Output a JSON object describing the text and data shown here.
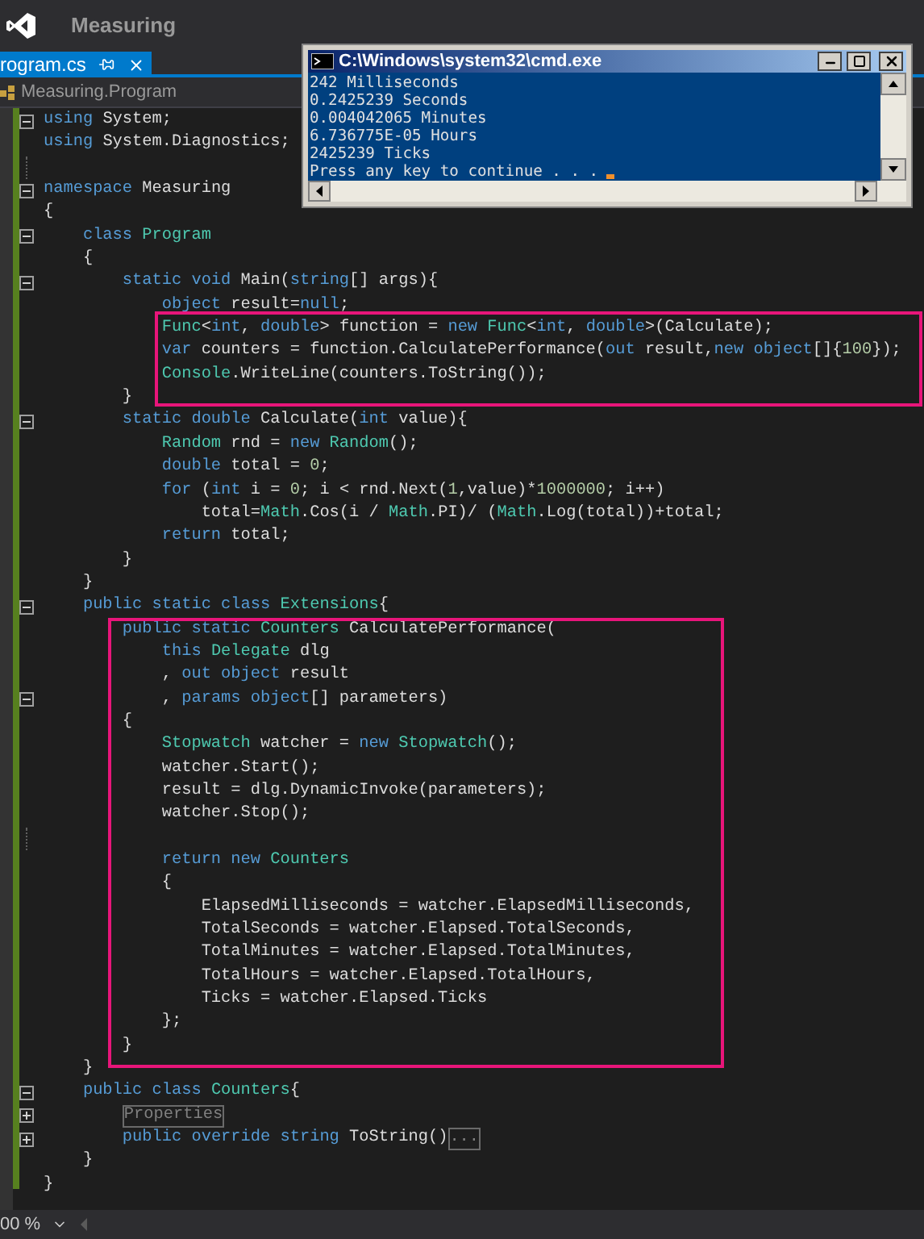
{
  "app": {
    "title": "Measuring"
  },
  "tab": {
    "label": "rogram.cs",
    "selected": true
  },
  "nav": {
    "label": "Measuring.Program"
  },
  "code": {
    "lines": [
      {
        "collapsed": false,
        "segs": [
          {
            "t": "using",
            "kind": "keyword"
          },
          {
            "t": " System;",
            "kind": "plain"
          }
        ]
      },
      {
        "segs": [
          {
            "t": "using",
            "kind": "keyword"
          },
          {
            "t": " System.Diagnostics;",
            "kind": "plain"
          }
        ]
      },
      {
        "kind": "blank"
      },
      {
        "collapsed": false,
        "segs": [
          {
            "t": "namespace",
            "kind": "keyword"
          },
          {
            "t": " Measuring",
            "kind": "plain"
          }
        ]
      },
      {
        "segs": [
          {
            "t": "{",
            "kind": "plain"
          }
        ]
      },
      {
        "collapsed": false,
        "segs": [
          {
            "t": "    class",
            "kind": "keyword"
          },
          {
            "t": " Program",
            "kind": "type"
          }
        ]
      },
      {
        "segs": [
          {
            "t": "    {",
            "kind": "plain"
          }
        ]
      },
      {
        "collapsed": false,
        "segs": [
          {
            "t": "        static void",
            "kind": "keyword"
          },
          {
            "t": " Main(",
            "kind": "plain"
          },
          {
            "t": "string",
            "kind": "keyword"
          },
          {
            "t": "[] args){",
            "kind": "plain"
          }
        ]
      },
      {
        "segs": [
          {
            "t": "            object",
            "kind": "keyword"
          },
          {
            "t": " result=",
            "kind": "plain"
          },
          {
            "t": "null",
            "kind": "keyword"
          },
          {
            "t": ";",
            "kind": "plain"
          }
        ]
      },
      {
        "segs": [
          {
            "t": "            Func",
            "kind": "type"
          },
          {
            "t": "<",
            "kind": "plain"
          },
          {
            "t": "int",
            "kind": "keyword"
          },
          {
            "t": ", ",
            "kind": "plain"
          },
          {
            "t": "double",
            "kind": "keyword"
          },
          {
            "t": "> function = ",
            "kind": "plain"
          },
          {
            "t": "new",
            "kind": "keyword"
          },
          {
            "t": " Func",
            "kind": "type"
          },
          {
            "t": "<",
            "kind": "plain"
          },
          {
            "t": "int",
            "kind": "keyword"
          },
          {
            "t": ", ",
            "kind": "plain"
          },
          {
            "t": "double",
            "kind": "keyword"
          },
          {
            "t": ">(Calculate);",
            "kind": "plain"
          }
        ]
      },
      {
        "segs": [
          {
            "t": "            var",
            "kind": "keyword"
          },
          {
            "t": " counters = function.CalculatePerformance(",
            "kind": "plain"
          },
          {
            "t": "out",
            "kind": "keyword"
          },
          {
            "t": " result,",
            "kind": "plain"
          },
          {
            "t": "new object",
            "kind": "keyword"
          },
          {
            "t": "[]{",
            "kind": "plain"
          },
          {
            "t": "100",
            "kind": "number"
          },
          {
            "t": "});",
            "kind": "plain"
          }
        ]
      },
      {
        "segs": [
          {
            "t": "            Console",
            "kind": "type"
          },
          {
            "t": ".WriteLine(counters.ToString());",
            "kind": "plain"
          }
        ]
      },
      {
        "segs": [
          {
            "t": "        }",
            "kind": "plain"
          }
        ]
      },
      {
        "collapsed": false,
        "segs": [
          {
            "t": "        static double",
            "kind": "keyword"
          },
          {
            "t": " Calculate(",
            "kind": "plain"
          },
          {
            "t": "int",
            "kind": "keyword"
          },
          {
            "t": " value){",
            "kind": "plain"
          }
        ]
      },
      {
        "segs": [
          {
            "t": "            Random",
            "kind": "type"
          },
          {
            "t": " rnd = ",
            "kind": "plain"
          },
          {
            "t": "new",
            "kind": "keyword"
          },
          {
            "t": " Random",
            "kind": "type"
          },
          {
            "t": "();",
            "kind": "plain"
          }
        ]
      },
      {
        "segs": [
          {
            "t": "            double",
            "kind": "keyword"
          },
          {
            "t": " total = ",
            "kind": "plain"
          },
          {
            "t": "0",
            "kind": "number"
          },
          {
            "t": ";",
            "kind": "plain"
          }
        ]
      },
      {
        "segs": [
          {
            "t": "            for",
            "kind": "keyword"
          },
          {
            "t": " (",
            "kind": "plain"
          },
          {
            "t": "int",
            "kind": "keyword"
          },
          {
            "t": " i = ",
            "kind": "plain"
          },
          {
            "t": "0",
            "kind": "number"
          },
          {
            "t": "; i < rnd.Next(",
            "kind": "plain"
          },
          {
            "t": "1",
            "kind": "number"
          },
          {
            "t": ",value)*",
            "kind": "plain"
          },
          {
            "t": "1000000",
            "kind": "number"
          },
          {
            "t": "; i++)",
            "kind": "plain"
          }
        ]
      },
      {
        "segs": [
          {
            "t": "                total=",
            "kind": "plain"
          },
          {
            "t": "Math",
            "kind": "type"
          },
          {
            "t": ".Cos(i / ",
            "kind": "plain"
          },
          {
            "t": "Math",
            "kind": "type"
          },
          {
            "t": ".PI)/ (",
            "kind": "plain"
          },
          {
            "t": "Math",
            "kind": "type"
          },
          {
            "t": ".Log(total))+total;",
            "kind": "plain"
          }
        ]
      },
      {
        "segs": [
          {
            "t": "            return",
            "kind": "keyword"
          },
          {
            "t": " total;",
            "kind": "plain"
          }
        ]
      },
      {
        "segs": [
          {
            "t": "        }",
            "kind": "plain"
          }
        ]
      },
      {
        "segs": [
          {
            "t": "    }",
            "kind": "plain"
          }
        ]
      },
      {
        "collapsed": false,
        "segs": [
          {
            "t": "    public static class",
            "kind": "keyword"
          },
          {
            "t": " Extensions",
            "kind": "type"
          },
          {
            "t": "{",
            "kind": "plain"
          }
        ]
      },
      {
        "segs": [
          {
            "t": "        public static",
            "kind": "keyword"
          },
          {
            "t": " Counters",
            "kind": "type"
          },
          {
            "t": " CalculatePerformance(",
            "kind": "plain"
          }
        ]
      },
      {
        "segs": [
          {
            "t": "            this",
            "kind": "keyword"
          },
          {
            "t": " Delegate",
            "kind": "type"
          },
          {
            "t": " dlg",
            "kind": "plain"
          }
        ]
      },
      {
        "segs": [
          {
            "t": "            ,",
            "kind": "plain"
          },
          {
            "t": " out object",
            "kind": "keyword"
          },
          {
            "t": " result",
            "kind": "plain"
          }
        ]
      },
      {
        "collapsed": false,
        "segs": [
          {
            "t": "            ,",
            "kind": "plain"
          },
          {
            "t": " params object",
            "kind": "keyword"
          },
          {
            "t": "[] parameters)",
            "kind": "plain"
          }
        ]
      },
      {
        "segs": [
          {
            "t": "        {",
            "kind": "plain"
          }
        ]
      },
      {
        "segs": [
          {
            "t": "            Stopwatch",
            "kind": "type"
          },
          {
            "t": " watcher = ",
            "kind": "plain"
          },
          {
            "t": "new",
            "kind": "keyword"
          },
          {
            "t": " Stopwatch",
            "kind": "type"
          },
          {
            "t": "();",
            "kind": "plain"
          }
        ]
      },
      {
        "segs": [
          {
            "t": "            watcher.Start();",
            "kind": "plain"
          }
        ]
      },
      {
        "segs": [
          {
            "t": "            result = dlg.DynamicInvoke(parameters);",
            "kind": "plain"
          }
        ]
      },
      {
        "segs": [
          {
            "t": "            watcher.Stop();",
            "kind": "plain"
          }
        ]
      },
      {
        "kind": "blank"
      },
      {
        "segs": [
          {
            "t": "            return new",
            "kind": "keyword"
          },
          {
            "t": " Counters",
            "kind": "type"
          }
        ]
      },
      {
        "segs": [
          {
            "t": "            {",
            "kind": "plain"
          }
        ]
      },
      {
        "segs": [
          {
            "t": "                ElapsedMilliseconds = watcher.ElapsedMilliseconds,",
            "kind": "plain"
          }
        ]
      },
      {
        "segs": [
          {
            "t": "                TotalSeconds = watcher.Elapsed.TotalSeconds,",
            "kind": "plain"
          }
        ]
      },
      {
        "segs": [
          {
            "t": "                TotalMinutes = watcher.Elapsed.TotalMinutes,",
            "kind": "plain"
          }
        ]
      },
      {
        "segs": [
          {
            "t": "                TotalHours = watcher.Elapsed.TotalHours,",
            "kind": "plain"
          }
        ]
      },
      {
        "segs": [
          {
            "t": "                Ticks = watcher.Elapsed.Ticks",
            "kind": "plain"
          }
        ]
      },
      {
        "segs": [
          {
            "t": "            };",
            "kind": "plain"
          }
        ]
      },
      {
        "segs": [
          {
            "t": "        }",
            "kind": "plain"
          }
        ]
      },
      {
        "segs": [
          {
            "t": "    }",
            "kind": "plain"
          }
        ]
      },
      {
        "collapsed": false,
        "segs": [
          {
            "t": "    public class",
            "kind": "keyword"
          },
          {
            "t": " Counters",
            "kind": "type"
          },
          {
            "t": "{",
            "kind": "plain"
          }
        ]
      },
      {
        "collapsed": true,
        "segs": [
          {
            "t": "        Properties",
            "kind": "folded"
          }
        ]
      },
      {
        "collapsed": true,
        "segs": [
          {
            "t": "        public override string",
            "kind": "keyword"
          },
          {
            "t": " ToString()",
            "kind": "plain"
          },
          {
            "t": "...",
            "kind": "folded"
          }
        ]
      },
      {
        "segs": [
          {
            "t": "    }",
            "kind": "plain"
          }
        ]
      },
      {
        "segs": [
          {
            "t": "}",
            "kind": "plain"
          }
        ]
      }
    ]
  },
  "console": {
    "title": "C:\\Windows\\system32\\cmd.exe",
    "lines": [
      "242 Milliseconds",
      "0.2425239 Seconds",
      "0.004042065 Minutes",
      "6.736775E-05 Hours",
      "2425239 Ticks",
      "Press any key to continue . . ."
    ]
  },
  "zoom": "00 %"
}
